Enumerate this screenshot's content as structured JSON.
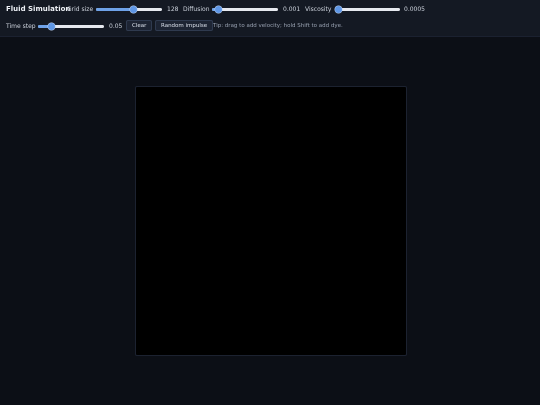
{
  "app": {
    "title": "Fluid Simulation"
  },
  "controls": {
    "grid_size": {
      "label": "Grid size",
      "value": "128",
      "fraction": 0.57
    },
    "diffusion": {
      "label": "Diffusion",
      "value": "0.001",
      "fraction": 0.1
    },
    "viscosity": {
      "label": "Viscosity",
      "value": "0.0005",
      "fraction": 0.06
    },
    "time_step": {
      "label": "Time step",
      "value": "0.05",
      "fraction": 0.2
    }
  },
  "buttons": {
    "clear": "Clear",
    "random_impulse": "Random impulse"
  },
  "tip": "Tip: drag to add velocity; hold Shift to add dye.",
  "colors": {
    "accent": "#6ea2e8",
    "background": "#0c0f16",
    "toolbar": "#141923",
    "canvas": "#000000"
  }
}
